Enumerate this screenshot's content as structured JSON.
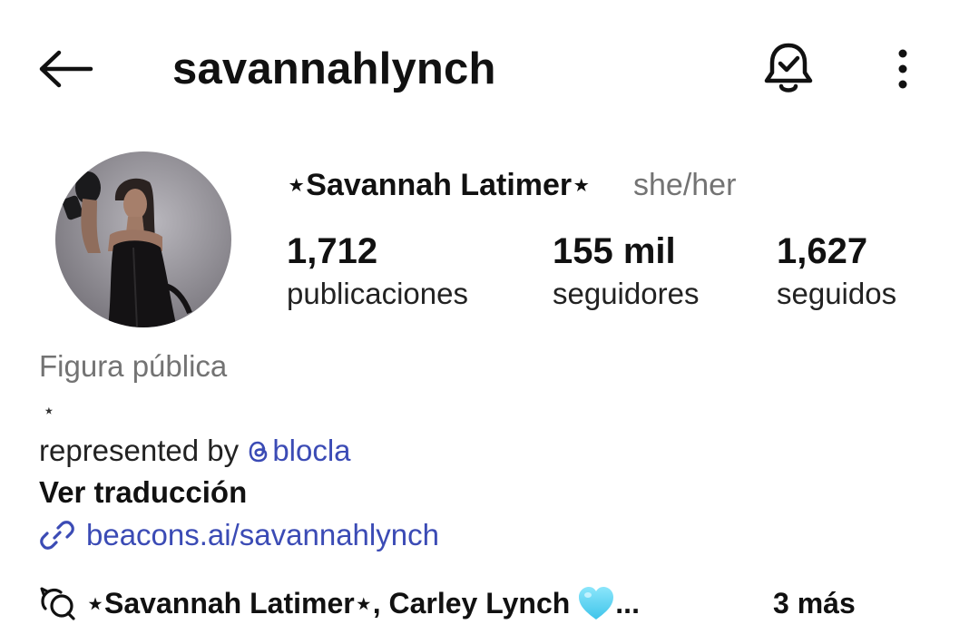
{
  "header": {
    "back_icon": "arrow-left-icon",
    "username": "savannahlynch",
    "bell_icon": "bell-check-icon",
    "more_icon": "vertical-dots-icon"
  },
  "profile": {
    "display_name": "⋆Savannah Latimer⋆",
    "pronouns": "she/her",
    "stats": {
      "posts": {
        "value": "1,712",
        "label": "publicaciones"
      },
      "followers": {
        "value": "155 mil",
        "label": "seguidores"
      },
      "following": {
        "value": "1,627",
        "label": "seguidos"
      }
    }
  },
  "bio": {
    "category": "Figura pública",
    "star": "⋆",
    "represented_prefix": "represented by ",
    "mention_icon": "threads-icon",
    "mention": "blocla",
    "translate_label": "Ver traducción",
    "link_icon": "link-icon",
    "link": "beacons.ai/savannahlynch"
  },
  "followed_by": {
    "icon": "threads-chat-icon",
    "text": "⋆Savannah Latimer⋆, Carley Lynch",
    "heart_icon": "light-blue-heart-icon",
    "ellipsis": "...",
    "more_label": "3 más"
  },
  "colors": {
    "link": "#3b4bb5",
    "muted": "#737373",
    "text": "#111111",
    "heart": "#5fd2f2"
  }
}
